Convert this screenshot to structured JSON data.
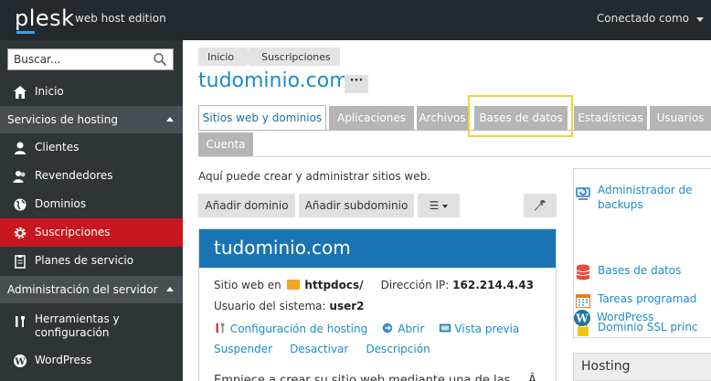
{
  "header": {
    "logo": "plesk",
    "edition": "web host edition",
    "connected_label": "Conectado como"
  },
  "sidebar": {
    "search_placeholder": "Buscar...",
    "home": "Inicio",
    "section_hosting": "Servicios de hosting",
    "items_hosting": [
      "Clientes",
      "Revendedores",
      "Dominios",
      "Suscripciones",
      "Planes de servicio"
    ],
    "section_admin": "Administración del servidor",
    "tools_line1": "Herramientas y",
    "tools_line2": "configuración",
    "wordpress": "WordPress",
    "active_color": "#c8171d"
  },
  "breadcrumb": [
    "Inicio",
    "Suscripciones"
  ],
  "page_title": "tudominio.com",
  "more_label": "···",
  "tabs": [
    {
      "label": "Sitios web y dominios",
      "active": true
    },
    {
      "label": "Aplicaciones"
    },
    {
      "label": "Archivos"
    },
    {
      "label": "Bases de datos",
      "highlighted": true
    },
    {
      "label": "Estadísticas"
    },
    {
      "label": "Usuarios"
    },
    {
      "label": "Cuenta"
    }
  ],
  "intro_text": "Aquí puede crear y administrar sitios web.",
  "toolbar": {
    "add_domain": "Añadir dominio",
    "add_subdomain": "Añadir subdominio",
    "menu_icon": "☰"
  },
  "site": {
    "name": "tudominio.com",
    "site_web_en": "Sitio web en",
    "docroot": "httpdocs/",
    "ip_label": "Dirección IP:",
    "ip": "162.214.4.43",
    "user_label": "Usuario del sistema:",
    "user": "user2",
    "hosting_config": "Configuración de hosting",
    "open": "Abrir",
    "preview": "Vista previa",
    "suspend": "Suspender",
    "deactivate": "Desactivar",
    "description": "Descripción",
    "bottom_text": "Empiece a crear su sitio web mediante una de las",
    "bottom_right": "Â"
  },
  "right_panel": {
    "items": [
      {
        "line1": "Administrador de",
        "line2": "backups"
      },
      {
        "line1": "Bases de datos"
      },
      {
        "line1": "Tareas programad"
      },
      {
        "line1": "Dominio SSL princ"
      },
      {
        "line1": "WordPress"
      }
    ],
    "hosting_title": "Hosting"
  },
  "colors": {
    "brand_blue": "#1a8ccc",
    "highlight": "#f0d43a"
  }
}
